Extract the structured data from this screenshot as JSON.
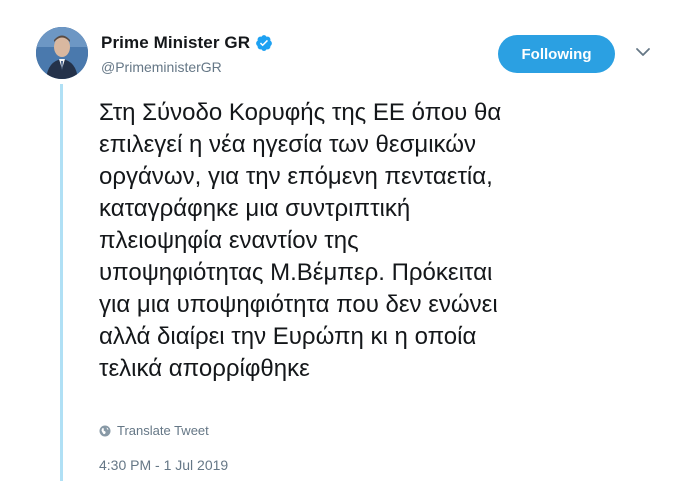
{
  "author": {
    "display_name": "Prime Minister GR",
    "handle": "@PrimeministerGR",
    "verified": true
  },
  "follow_button": {
    "label": "Following"
  },
  "tweet": {
    "lines": [
      "Στη Σύνοδο Κορυφής της ΕΕ όπου θα",
      "επιλεγεί η νέα ηγεσία των θεσμικών",
      "οργάνων, για την επόμενη πενταετία,",
      "καταγράφηκε μια συντριπτική",
      "πλειοψηφία εναντίον της",
      "υποψηφιότητας Μ.Βέμπερ. Πρόκειται",
      "για μια υποψηφιότητα που δεν ενώνει",
      "αλλά διαίρει την Ευρώπη κι η οποία",
      "τελικά απορρίφθηκε"
    ],
    "translate_label": "Translate Tweet",
    "timestamp": "4:30 PM - 1 Jul 2019"
  },
  "colors": {
    "accent": "#2ba0e2",
    "muted_text": "#657786",
    "thread_line": "#b0e0f5"
  },
  "icons": {
    "verified": "verified-badge-icon",
    "caret": "chevron-down-icon",
    "translate": "globe-icon"
  }
}
